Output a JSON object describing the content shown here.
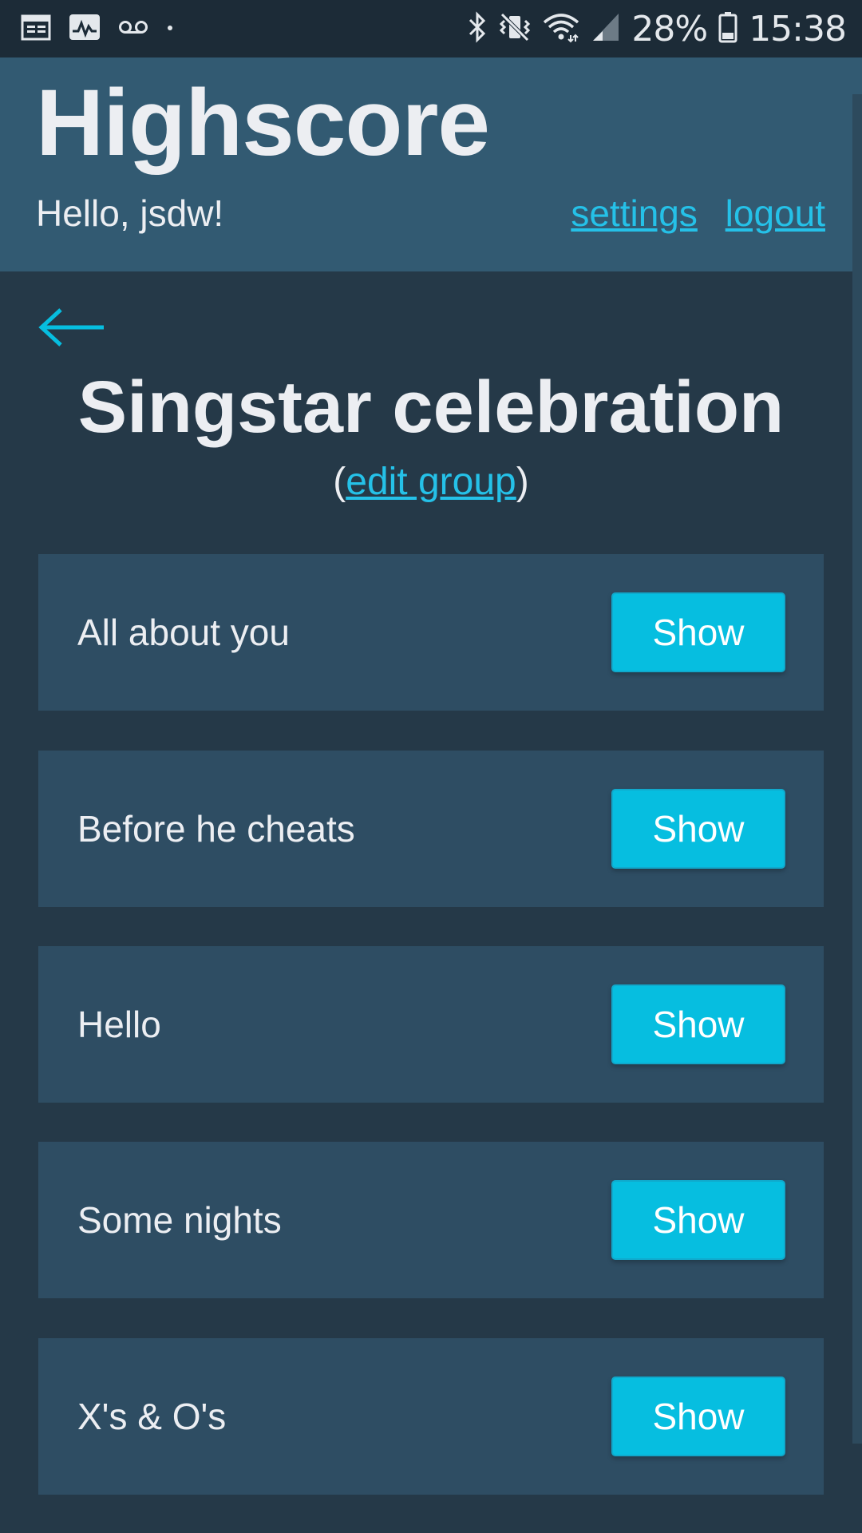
{
  "status_bar": {
    "left_icons": [
      "calendar-icon",
      "activity-icon",
      "voicemail-icon",
      "dot-icon"
    ],
    "right_icons": [
      "bluetooth-icon",
      "vibrate-mute-icon",
      "wifi-icon",
      "signal-icon",
      "battery-icon"
    ],
    "battery_percent": "28%",
    "time": "15:38"
  },
  "header": {
    "app_title": "Highscore",
    "greeting": "Hello, jsdw!",
    "settings_label": "settings",
    "logout_label": "logout"
  },
  "group": {
    "back_icon": "arrow-left-icon",
    "title": "Singstar celebration",
    "edit_open": "(",
    "edit_label": "edit group",
    "edit_close": ")"
  },
  "songs": [
    {
      "title": "All about you",
      "button": "Show"
    },
    {
      "title": "Before he cheats",
      "button": "Show"
    },
    {
      "title": "Hello",
      "button": "Show"
    },
    {
      "title": "Some nights",
      "button": "Show"
    },
    {
      "title": "X's & O's",
      "button": "Show"
    }
  ],
  "colors": {
    "background": "#253948",
    "header_bg": "#325a72",
    "row_bg": "#2e4d63",
    "accent": "#06bee0",
    "link": "#25c1e8"
  }
}
